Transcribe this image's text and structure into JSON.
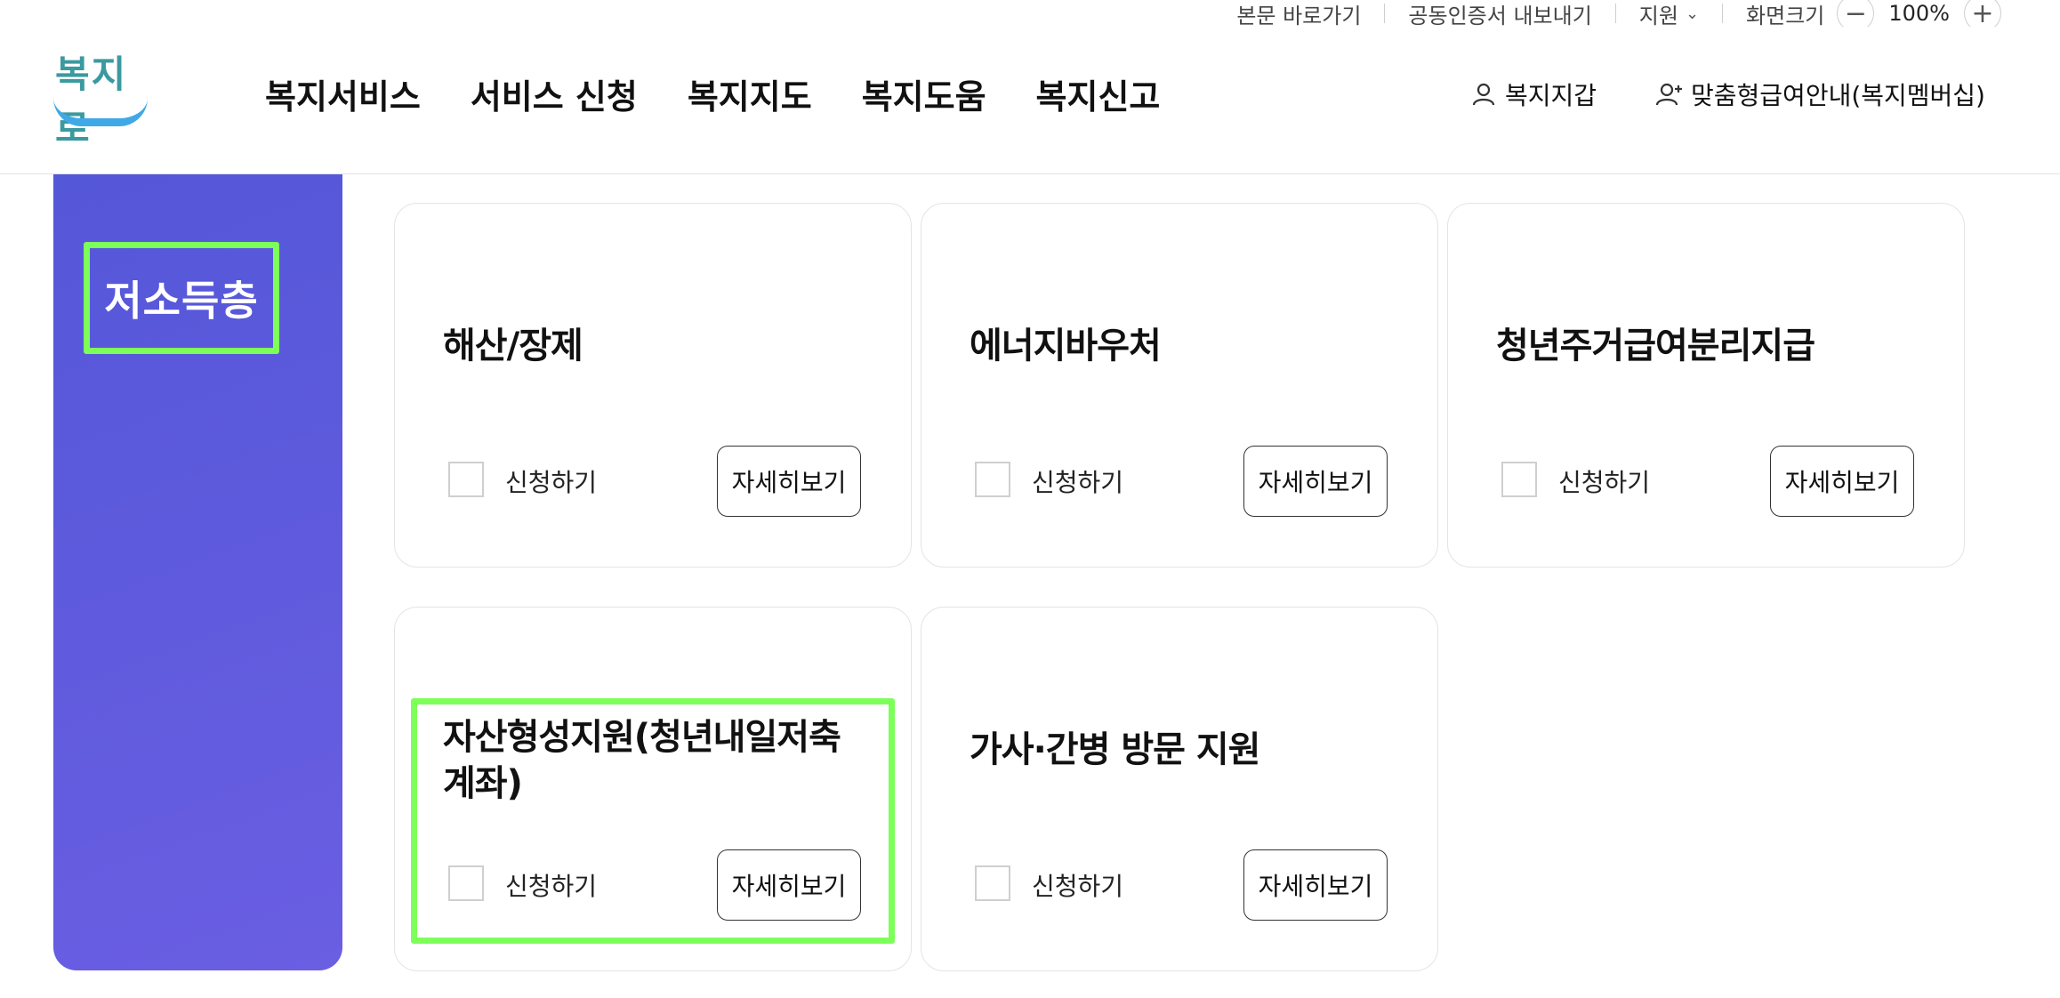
{
  "utility": {
    "skip_link": "본문 바로가기",
    "cert_export": "공동인증서 내보내기",
    "language": "지원",
    "zoom_label": "화면크기",
    "zoom_minus": "−",
    "zoom_value": "100%",
    "zoom_plus": "+"
  },
  "header": {
    "logo_text": "복지로",
    "nav": [
      "복지서비스",
      "서비스 신청",
      "복지지도",
      "복지도움",
      "복지신고"
    ],
    "wallet": "복지지갑",
    "membership": "맞춤형급여안내(복지멤버십)"
  },
  "sidebar": {
    "title": "저소득층"
  },
  "cards": [
    {
      "title": "해산/장제",
      "apply_label": "신청하기",
      "detail_label": "자세히보기"
    },
    {
      "title": "에너지바우처",
      "apply_label": "신청하기",
      "detail_label": "자세히보기"
    },
    {
      "title": "청년주거급여분리지급",
      "apply_label": "신청하기",
      "detail_label": "자세히보기"
    },
    {
      "title": "자산형성지원(청년내일저축계좌)",
      "apply_label": "신청하기",
      "detail_label": "자세히보기"
    },
    {
      "title": "가사·간병 방문 지원",
      "apply_label": "신청하기",
      "detail_label": "자세히보기"
    }
  ],
  "colors": {
    "sidebar_start": "#5457d8",
    "sidebar_end": "#6a5ee3",
    "highlight": "#7dff5a",
    "logo_teal": "#3a9a9f",
    "logo_blue": "#3fa9e8"
  }
}
